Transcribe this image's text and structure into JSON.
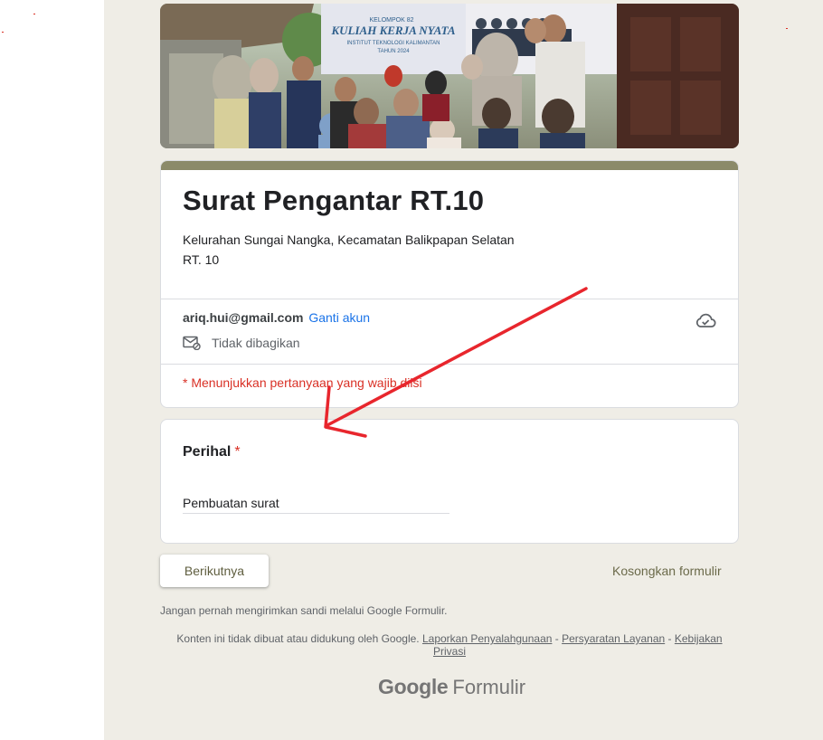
{
  "form": {
    "title": "Surat Pengantar RT.10",
    "description_line1": "Kelurahan Sungai Nangka, Kecamatan Balikpapan Selatan",
    "description_line2": "RT. 10",
    "header_banner": {
      "line1": "KELOMPOK 82",
      "line2": "KULIAH KERJA NYATA",
      "line3": "INSTITUT TEKNOLOGI KALIMANTAN",
      "line4": "TAHUN 2024"
    }
  },
  "account": {
    "email": "ariq.hui@gmail.com",
    "switch_label": "Ganti akun",
    "share_status": "Tidak dibagikan",
    "cloud_icon": "cloud-done-icon",
    "mail_icon": "mail-not-shared-icon"
  },
  "required_note": "* Menunjukkan pertanyaan yang wajib diisi",
  "question": {
    "label": "Perihal",
    "required_mark": "*",
    "answer": "Pembuatan surat"
  },
  "actions": {
    "next_label": "Berikutnya",
    "clear_label": "Kosongkan formulir"
  },
  "footer": {
    "warning": "Jangan pernah mengirimkan sandi melalui Google Formulir.",
    "disclaimer": "Konten ini tidak dibuat atau didukung oleh Google.",
    "report_link": "Laporkan Penyalahgunaan",
    "terms_link": "Persyaratan Layanan",
    "privacy_link": "Kebijakan Privasi",
    "separator": " - ",
    "brand_google": "Google",
    "brand_product": "Formulir"
  },
  "colors": {
    "accent": "#8b8a6a",
    "background": "#efede6",
    "link": "#1a73e8",
    "required": "#d93025",
    "annotation_arrow": "#e8262d"
  }
}
